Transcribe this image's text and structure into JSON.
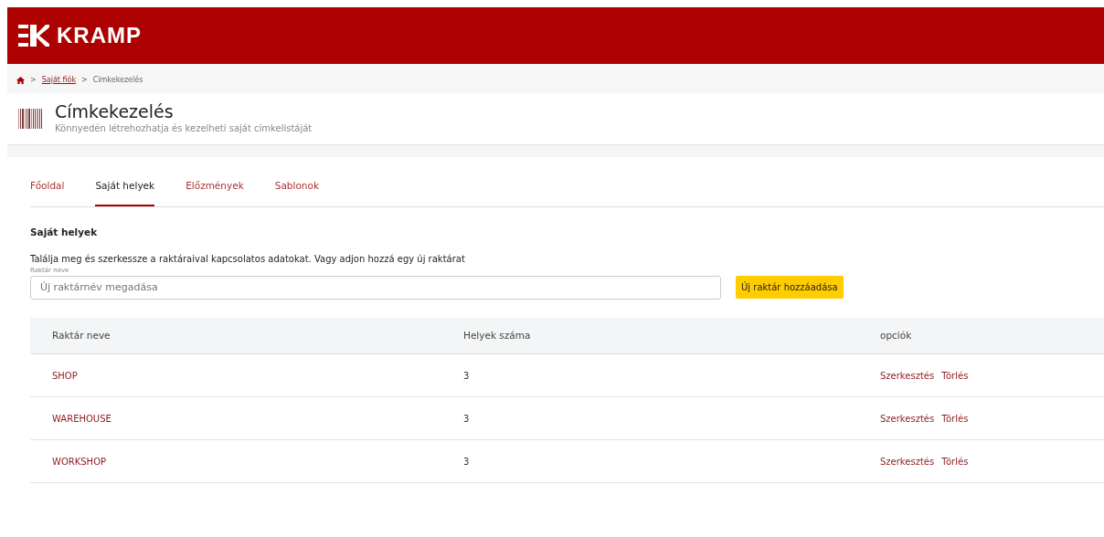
{
  "header": {
    "logo_text": "KRAMP"
  },
  "breadcrumb": [
    {
      "label": "Saját fiók"
    },
    {
      "label": "Címkekezelés"
    }
  ],
  "breadcrumb_separator": ">",
  "page": {
    "title": "Címkekezelés",
    "subtitle": "Könnyedén létrehozhatja és kezelheti saját címkelistáját"
  },
  "tabs": [
    {
      "label": "Főoldal",
      "selected": false
    },
    {
      "label": "Saját helyek",
      "selected": true
    },
    {
      "label": "Előzmények",
      "selected": false
    },
    {
      "label": "Sablonok",
      "selected": false
    }
  ],
  "section": {
    "title": "Saját helyek",
    "description": "Találja meg és szerkessze a raktáraival kapcsolatos adatokat. Vagy adjon hozzá egy új raktárat",
    "field_label": "Raktár neve",
    "placeholder": "Új raktárnév megadása",
    "button": "Új raktár hozzáadása"
  },
  "table": {
    "columns": [
      "Raktár neve",
      "Helyek száma",
      "opciók"
    ],
    "rows": [
      {
        "name": "SHOP",
        "count": "3",
        "actions": [
          "Szerkesztés",
          "Törlés"
        ]
      },
      {
        "name": "WAREHOUSE",
        "count": "3",
        "actions": [
          "Szerkesztés",
          "Törlés"
        ]
      },
      {
        "name": "WORKSHOP",
        "count": "3",
        "actions": [
          "Szerkesztés",
          "Törlés"
        ]
      }
    ]
  }
}
